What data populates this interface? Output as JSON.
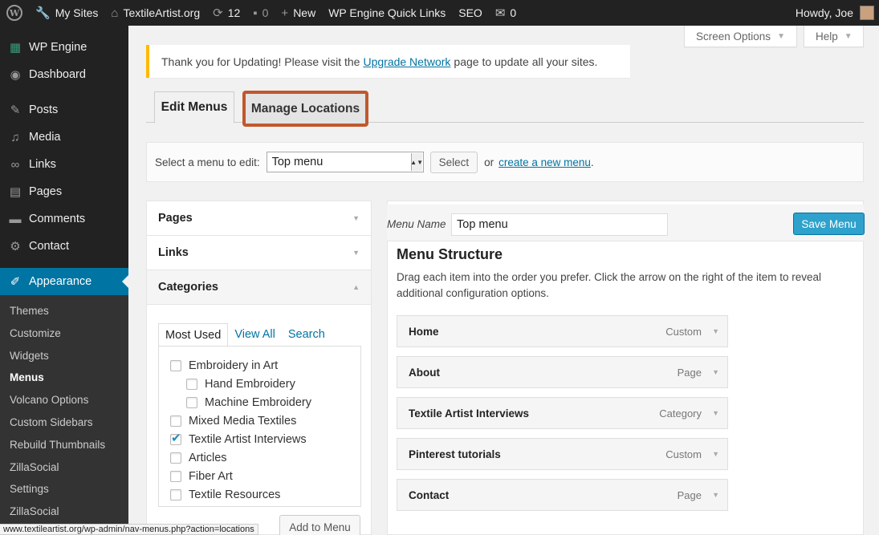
{
  "adminbar": {
    "my_sites": "My Sites",
    "site": "TextileArtist.org",
    "updates": "12",
    "comments": "0",
    "new": "New",
    "quick_links": "WP Engine Quick Links",
    "seo": "SEO",
    "messages": "0",
    "howdy": "Howdy, Joe"
  },
  "sidebar": {
    "items": [
      {
        "label": "WP Engine",
        "icon": "grid-icon"
      },
      {
        "label": "Dashboard",
        "icon": "dashboard-icon"
      },
      {
        "label": "Posts",
        "icon": "pin-icon"
      },
      {
        "label": "Media",
        "icon": "media-icon"
      },
      {
        "label": "Links",
        "icon": "link-icon"
      },
      {
        "label": "Pages",
        "icon": "pages-icon"
      },
      {
        "label": "Comments",
        "icon": "comment-icon"
      },
      {
        "label": "Contact",
        "icon": "gear-icon"
      },
      {
        "label": "Appearance",
        "icon": "brush-icon"
      }
    ],
    "sub": [
      "Themes",
      "Customize",
      "Widgets",
      "Menus",
      "Volcano Options",
      "Custom Sidebars",
      "Rebuild Thumbnails",
      "ZillaSocial",
      "Settings",
      "ZillaSocial"
    ]
  },
  "screen_options": "Screen Options",
  "help": "Help",
  "notice": {
    "before": "Thank you for Updating! Please visit the",
    "link": "Upgrade Network",
    "after": "page to update all your sites."
  },
  "tabs": {
    "edit": "Edit Menus",
    "manage": "Manage Locations"
  },
  "select_bar": {
    "label": "Select a menu to edit:",
    "value": "Top menu",
    "button": "Select",
    "or": "or",
    "create_link": "create a new menu",
    "period": "."
  },
  "accordion": {
    "pages": "Pages",
    "links": "Links",
    "categories": "Categories",
    "cat_tabs": [
      "Most Used",
      "View All",
      "Search"
    ],
    "cats": [
      {
        "label": "Embroidery in Art",
        "checked": false,
        "child": false
      },
      {
        "label": "Hand Embroidery",
        "checked": false,
        "child": true
      },
      {
        "label": "Machine Embroidery",
        "checked": false,
        "child": true
      },
      {
        "label": "Mixed Media Textiles",
        "checked": false,
        "child": false
      },
      {
        "label": "Textile Artist Interviews",
        "checked": true,
        "child": false
      },
      {
        "label": "Articles",
        "checked": false,
        "child": false
      },
      {
        "label": "Fiber Art",
        "checked": false,
        "child": false
      },
      {
        "label": "Textile Resources",
        "checked": false,
        "child": false
      }
    ],
    "add_button": "Add to Menu"
  },
  "menu_edit": {
    "name_label": "Menu Name",
    "name_value": "Top menu",
    "save": "Save Menu",
    "structure_title": "Menu Structure",
    "structure_desc": "Drag each item into the order you prefer. Click the arrow on the right of the item to reveal additional configuration options.",
    "items": [
      {
        "title": "Home",
        "type": "Custom"
      },
      {
        "title": "About",
        "type": "Page"
      },
      {
        "title": "Textile Artist Interviews",
        "type": "Category"
      },
      {
        "title": "Pinterest tutorials",
        "type": "Custom"
      },
      {
        "title": "Contact",
        "type": "Page"
      }
    ]
  },
  "status_url": "www.textileartist.org/wp-admin/nav-menus.php?action=locations",
  "colors": {
    "accent": "#0074a2",
    "save_button": "#2ea2cc",
    "highlight_box": "#c0582d",
    "notice_border": "#ffba00"
  }
}
